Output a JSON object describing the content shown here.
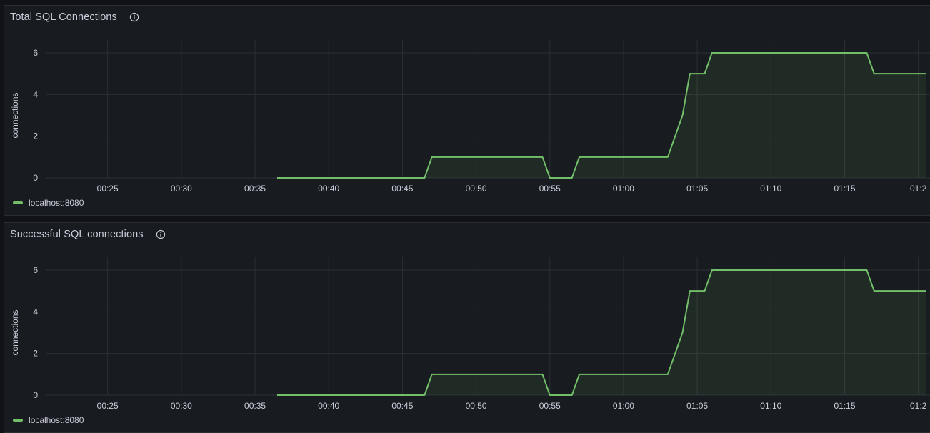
{
  "panels": [
    {
      "title": "Total SQL Connections",
      "legend": "localhost:8080"
    },
    {
      "title": "Successful SQL connections",
      "legend": "localhost:8080"
    }
  ],
  "colors": {
    "series": "#73bf69",
    "grid": "#2c2f35",
    "panel_bg": "#181b1f",
    "text": "#ccccdc"
  },
  "icons": [
    "info-icon"
  ],
  "chart_data": [
    {
      "type": "area",
      "title": "Total SQL Connections",
      "ylabel": "connections",
      "xlabel": "",
      "x_tick_labels": [
        "00:25",
        "00:30",
        "00:35",
        "00:40",
        "00:45",
        "00:50",
        "00:55",
        "01:00",
        "01:05",
        "01:10",
        "01:15",
        "01:2"
      ],
      "x_tick_minutes": [
        25,
        30,
        35,
        40,
        45,
        50,
        55,
        60,
        65,
        70,
        75,
        80
      ],
      "y_ticks": [
        0,
        2,
        4,
        6
      ],
      "xlim": [
        20.8,
        80.5
      ],
      "ylim": [
        0,
        6
      ],
      "legend_position": "bottom-left",
      "series": [
        {
          "name": "localhost:8080",
          "x": [
            "00:36:30",
            "00:46:30",
            "00:47:00",
            "00:54:30",
            "00:55:00",
            "00:56:30",
            "00:57:00",
            "01:03:00",
            "01:04:00",
            "01:04:30",
            "01:05:30",
            "01:06:00",
            "01:16:30",
            "01:17:00",
            "01:20:30"
          ],
          "x_minutes": [
            36.5,
            46.5,
            47.0,
            54.5,
            55.0,
            56.5,
            57.0,
            63.0,
            64.0,
            64.5,
            65.5,
            66.0,
            76.5,
            77.0,
            80.5
          ],
          "values": [
            0,
            0,
            1,
            1,
            0,
            0,
            1,
            1,
            3,
            5,
            5,
            6,
            6,
            5,
            5
          ]
        }
      ]
    },
    {
      "type": "area",
      "title": "Successful SQL connections",
      "ylabel": "connections",
      "xlabel": "",
      "x_tick_labels": [
        "00:25",
        "00:30",
        "00:35",
        "00:40",
        "00:45",
        "00:50",
        "00:55",
        "01:00",
        "01:05",
        "01:10",
        "01:15",
        "01:2"
      ],
      "x_tick_minutes": [
        25,
        30,
        35,
        40,
        45,
        50,
        55,
        60,
        65,
        70,
        75,
        80
      ],
      "y_ticks": [
        0,
        2,
        4,
        6
      ],
      "xlim": [
        20.8,
        80.5
      ],
      "ylim": [
        0,
        6
      ],
      "legend_position": "bottom-left",
      "series": [
        {
          "name": "localhost:8080",
          "x": [
            "00:36:30",
            "00:46:30",
            "00:47:00",
            "00:54:30",
            "00:55:00",
            "00:56:30",
            "00:57:00",
            "01:03:00",
            "01:04:00",
            "01:04:30",
            "01:05:30",
            "01:06:00",
            "01:16:30",
            "01:17:00",
            "01:20:30"
          ],
          "x_minutes": [
            36.5,
            46.5,
            47.0,
            54.5,
            55.0,
            56.5,
            57.0,
            63.0,
            64.0,
            64.5,
            65.5,
            66.0,
            76.5,
            77.0,
            80.5
          ],
          "values": [
            0,
            0,
            1,
            1,
            0,
            0,
            1,
            1,
            3,
            5,
            5,
            6,
            6,
            5,
            5
          ]
        }
      ]
    }
  ]
}
